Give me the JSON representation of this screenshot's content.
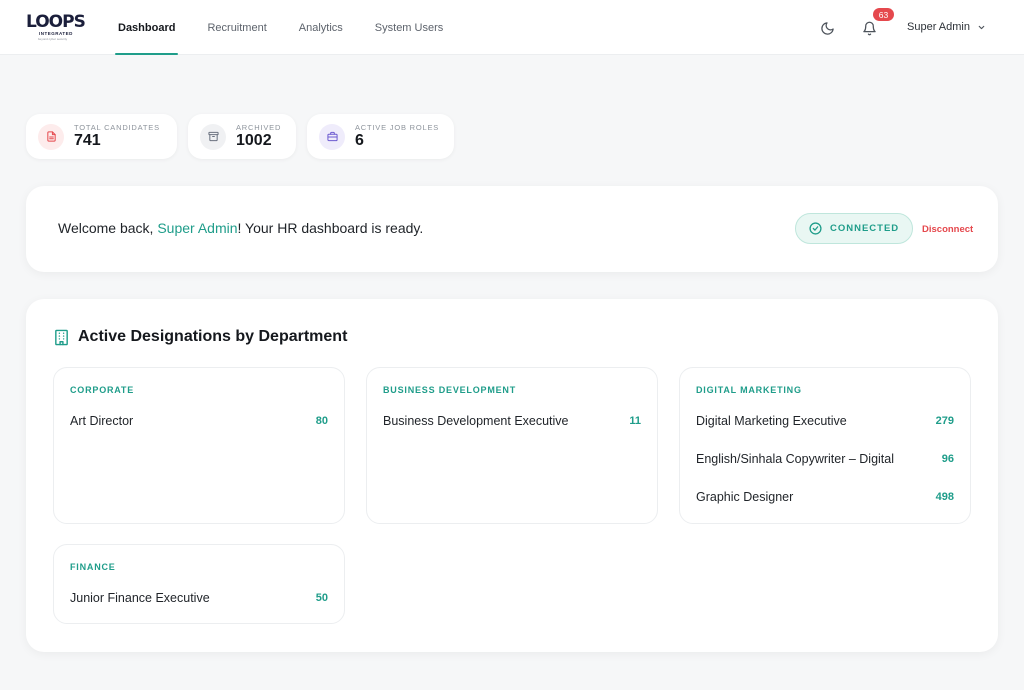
{
  "brand": {
    "logo_text": "LOOPS",
    "logo_sub": "INTEGRATED",
    "logo_tag": "beyond cyber security"
  },
  "nav": {
    "items": [
      {
        "label": "Dashboard",
        "active": true
      },
      {
        "label": "Recruitment",
        "active": false
      },
      {
        "label": "Analytics",
        "active": false
      },
      {
        "label": "System Users",
        "active": false
      }
    ]
  },
  "header": {
    "theme_icon": "moon-icon",
    "notifications_icon": "bell-icon",
    "notification_count": "63",
    "user_name": "Super Admin"
  },
  "stats": [
    {
      "label": "TOTAL CANDIDATES",
      "value": "741",
      "icon": "document-icon",
      "color": "#e5484d",
      "bg": "#fdecec"
    },
    {
      "label": "ARCHIVED",
      "value": "1002",
      "icon": "archive-icon",
      "color": "#6b7280",
      "bg": "#f0f1f3"
    },
    {
      "label": "ACTIVE JOB ROLES",
      "value": "6",
      "icon": "briefcase-icon",
      "color": "#6d5bd0",
      "bg": "#efecfb"
    }
  ],
  "welcome": {
    "prefix": "Welcome back, ",
    "user": "Super Admin",
    "suffix": "! Your HR dashboard is ready.",
    "status_label": "CONNECTED",
    "disconnect_label": "Disconnect"
  },
  "designations": {
    "title": "Active Designations by Department",
    "departments": [
      {
        "name": "CORPORATE",
        "roles": [
          {
            "title": "Art Director",
            "count": "80"
          }
        ]
      },
      {
        "name": "BUSINESS DEVELOPMENT",
        "roles": [
          {
            "title": "Business Development Executive",
            "count": "11"
          }
        ]
      },
      {
        "name": "DIGITAL MARKETING",
        "roles": [
          {
            "title": "Digital Marketing Executive",
            "count": "279"
          },
          {
            "title": "English/Sinhala Copywriter – Digital",
            "count": "96"
          },
          {
            "title": "Graphic Designer",
            "count": "498"
          }
        ]
      },
      {
        "name": "FINANCE",
        "roles": [
          {
            "title": "Junior Finance Executive",
            "count": "50"
          }
        ]
      }
    ]
  },
  "colors": {
    "accent": "#1f9d8a",
    "danger": "#e5484d"
  }
}
